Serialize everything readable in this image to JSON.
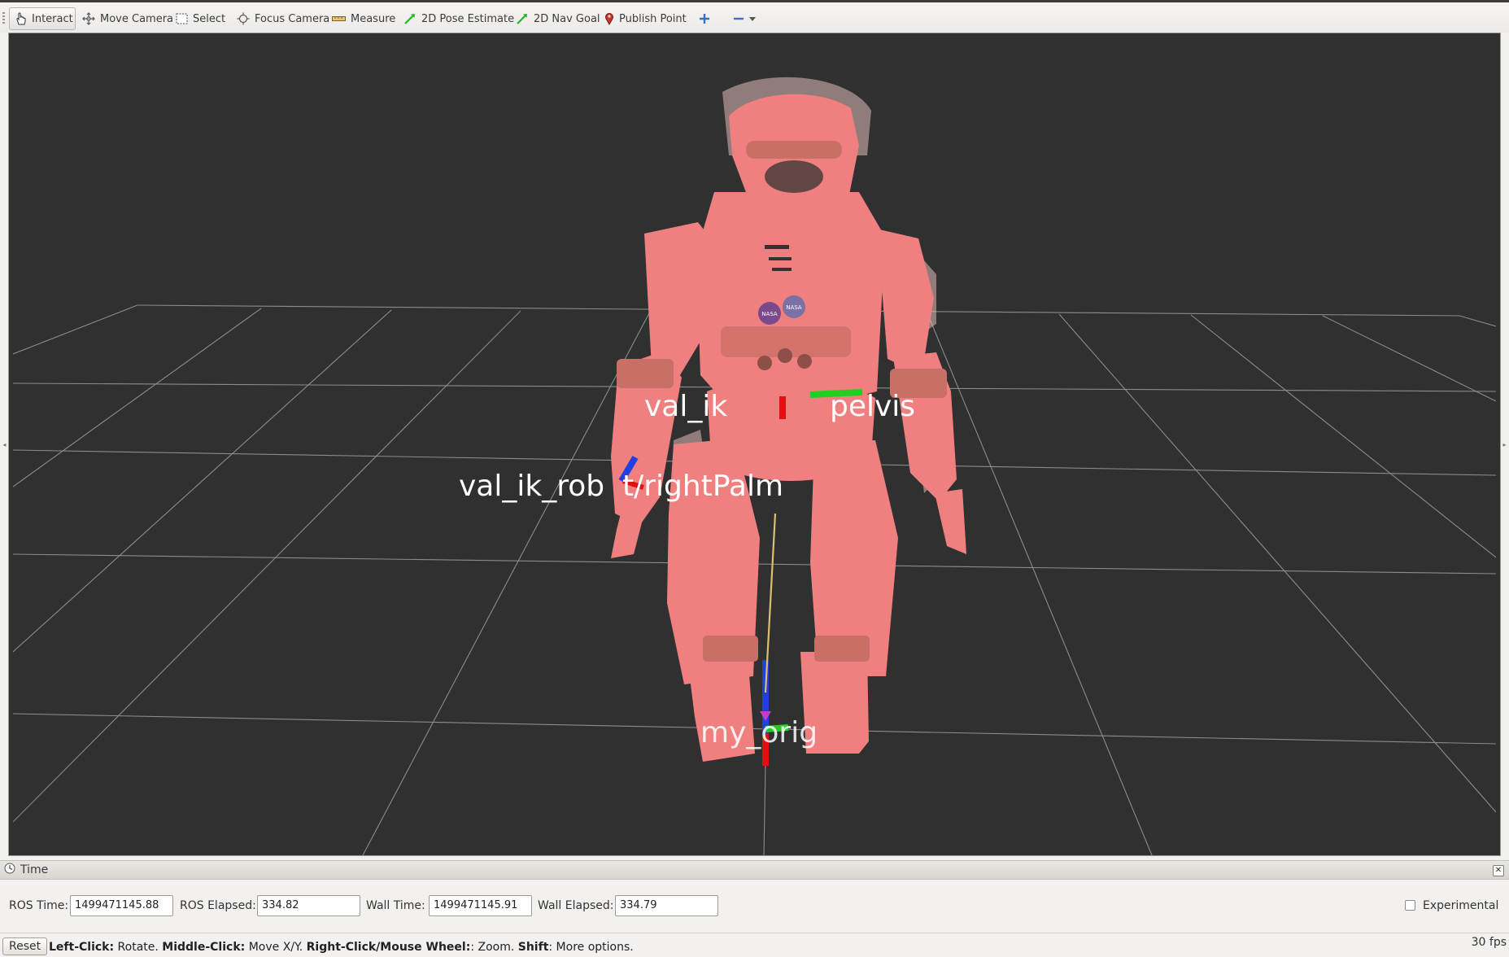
{
  "toolbar": {
    "tools": [
      {
        "label": "Interact",
        "icon": "hand-pointer-icon",
        "active": true
      },
      {
        "label": "Move Camera",
        "icon": "move-camera-icon"
      },
      {
        "label": "Select",
        "icon": "selection-box-icon"
      },
      {
        "label": "Focus Camera",
        "icon": "focus-target-icon"
      },
      {
        "label": "Measure",
        "icon": "ruler-icon"
      },
      {
        "label": "2D Pose Estimate",
        "icon": "green-arrow-icon"
      },
      {
        "label": "2D Nav Goal",
        "icon": "green-arrow-icon"
      },
      {
        "label": "Publish Point",
        "icon": "map-pin-icon"
      }
    ],
    "add_tool_icon": "plus-icon",
    "remove_tool_icon": "minus-icon",
    "dropdown_icon": "dropdown-arrow-icon"
  },
  "viewport": {
    "background_color": "#303030",
    "grid_color": "#8c8c8c",
    "robot_color": "#f08080",
    "frame_labels": {
      "pelvis": "val_ik_robot/pelvis",
      "right_palm": "val_ik_robot/rightPalm",
      "origin": "my_origin"
    },
    "pelvis_visible_left": "val_ik",
    "pelvis_visible_right": "pelvis",
    "palm_visible_left": "val_ik_rob",
    "palm_visible_right": "t/rightPalm",
    "origin_visible": "my_orig",
    "badge_text": "NASA"
  },
  "time_panel": {
    "title": "Time",
    "ros_time_label": "ROS Time:",
    "ros_time": "1499471145.88",
    "ros_elapsed_label": "ROS Elapsed:",
    "ros_elapsed": "334.82",
    "wall_time_label": "Wall Time:",
    "wall_time": "1499471145.91",
    "wall_elapsed_label": "Wall Elapsed:",
    "wall_elapsed": "334.79",
    "experimental_label": "Experimental",
    "experimental_checked": false
  },
  "statusbar": {
    "reset_label": "Reset",
    "left_click_key": "Left-Click:",
    "left_click_desc": " Rotate. ",
    "middle_click_key": "Middle-Click:",
    "middle_click_desc": " Move X/Y. ",
    "right_click_key": "Right-Click/Mouse Wheel:",
    "right_click_desc": ": Zoom. ",
    "shift_key": "Shift",
    "shift_desc": ": More options.",
    "fps": "30 fps"
  }
}
